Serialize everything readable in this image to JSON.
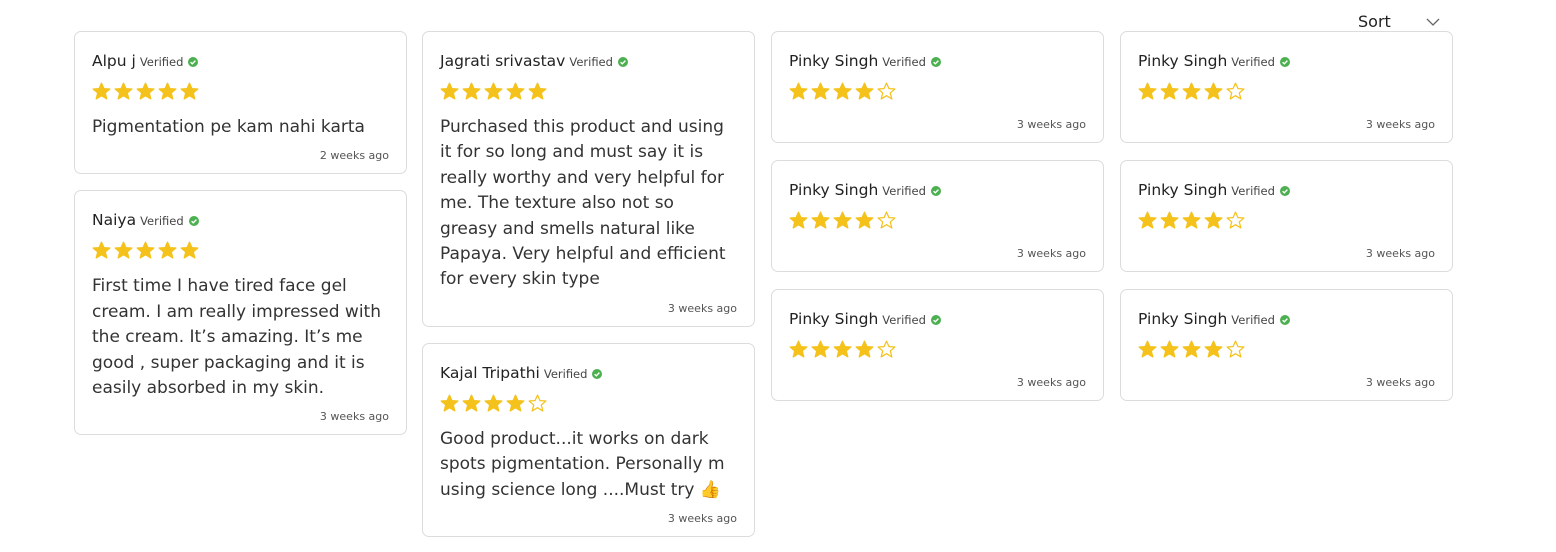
{
  "toolbar": {
    "sort_label": "Sort"
  },
  "verified_label": "Verified",
  "colors": {
    "star": "#f4c21b",
    "verified": "#4caf50",
    "border": "#dcdcdc"
  },
  "columns": [
    [
      {
        "name": "Alpu j",
        "rating": 5,
        "text": "Pigmentation pe kam nahi karta",
        "date": "2 weeks ago"
      },
      {
        "name": "Naiya",
        "rating": 5,
        "text": "First time I have tired face gel cream. I am really impressed with the cream. It’s amazing. It’s me good , super packaging and it is easily absorbed in my skin.",
        "date": "3 weeks ago"
      }
    ],
    [
      {
        "name": "Jagrati srivastav",
        "rating": 5,
        "text": "Purchased this product and using it for so long and must say it is really worthy and very helpful for me. The texture also not so greasy and smells natural like Papaya. Very helpful and efficient for every skin type",
        "date": "3 weeks ago"
      },
      {
        "name": "Kajal Tripathi",
        "rating": 4,
        "text": "Good product...it works on dark spots pigmentation. Personally m using science long ....Must try 👍",
        "date": "3 weeks ago"
      }
    ],
    [
      {
        "name": "Pinky Singh",
        "rating": 4,
        "text": "",
        "date": "3 weeks ago"
      },
      {
        "name": "Pinky Singh",
        "rating": 4,
        "text": "",
        "date": "3 weeks ago"
      },
      {
        "name": "Pinky Singh",
        "rating": 4,
        "text": "",
        "date": "3 weeks ago"
      }
    ],
    [
      {
        "name": "Pinky Singh",
        "rating": 4,
        "text": "",
        "date": "3 weeks ago"
      },
      {
        "name": "Pinky Singh",
        "rating": 4,
        "text": "",
        "date": "3 weeks ago"
      },
      {
        "name": "Pinky Singh",
        "rating": 4,
        "text": "",
        "date": "3 weeks ago"
      }
    ]
  ]
}
